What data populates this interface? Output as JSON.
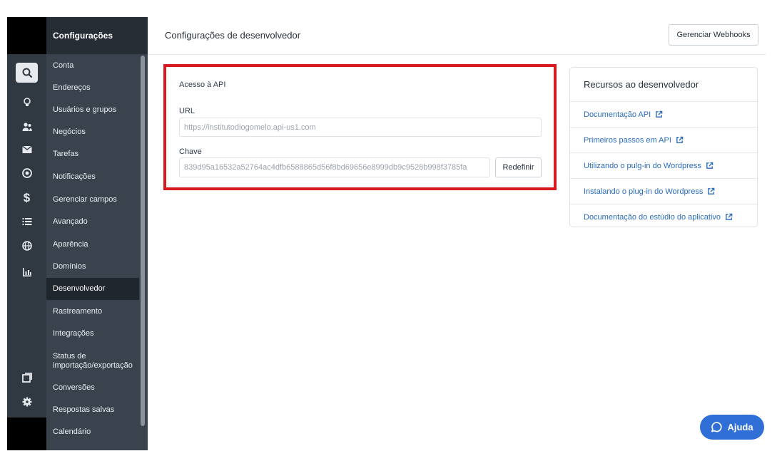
{
  "colors": {
    "rail_bg": "#303841",
    "menu_bg": "#3a434d",
    "menu_header_bg": "#262d35",
    "menu_active_bg": "#20262d",
    "highlight_border": "#d71920",
    "link": "#2a6bbd",
    "help_button": "#2f6fd6"
  },
  "rail": {
    "icons": [
      "search-icon",
      "lightbulb-icon",
      "contacts-icon",
      "mail-icon",
      "target-icon",
      "dollar-icon",
      "list-icon",
      "globe-icon",
      "bar-chart-icon",
      "window-icon",
      "gear-icon"
    ],
    "active": "search-icon"
  },
  "sidebar": {
    "title": "Configurações",
    "active_item": "Desenvolvedor",
    "items": [
      {
        "label": "Conta"
      },
      {
        "label": "Endereços"
      },
      {
        "label": "Usuários e grupos"
      },
      {
        "label": "Negócios"
      },
      {
        "label": "Tarefas"
      },
      {
        "label": "Notificações"
      },
      {
        "label": "Gerenciar campos"
      },
      {
        "label": "Avançado"
      },
      {
        "label": "Aparência"
      },
      {
        "label": "Domínios"
      },
      {
        "label": "Desenvolvedor"
      },
      {
        "label": "Rastreamento"
      },
      {
        "label": "Integrações"
      },
      {
        "label": "Status de importação/exportação"
      },
      {
        "label": "Conversões"
      },
      {
        "label": "Respostas salvas"
      },
      {
        "label": "Calendário"
      }
    ]
  },
  "header": {
    "title": "Configurações de desenvolvedor",
    "webhooks_button": "Gerenciar Webhooks"
  },
  "api_access": {
    "title": "Acesso à API",
    "url_label": "URL",
    "url_value": "https://institutodiogomelo.api-us1.com",
    "key_label": "Chave",
    "key_value": "839d95a16532a52764ac4dfb6588865d56f8bd69656e8999db9c9528b998f3785fa",
    "reset_button": "Redefinir"
  },
  "resources": {
    "title": "Recursos ao desenvolvedor",
    "links": [
      {
        "label": "Documentação API"
      },
      {
        "label": "Primeiros passos em API"
      },
      {
        "label": "Utilizando o pulg-in do Wordpress"
      },
      {
        "label": "Instalando o plug-in do Wordpress"
      },
      {
        "label": "Documentação do estúdio do aplicativo"
      }
    ]
  },
  "help": {
    "label": "Ajuda"
  }
}
